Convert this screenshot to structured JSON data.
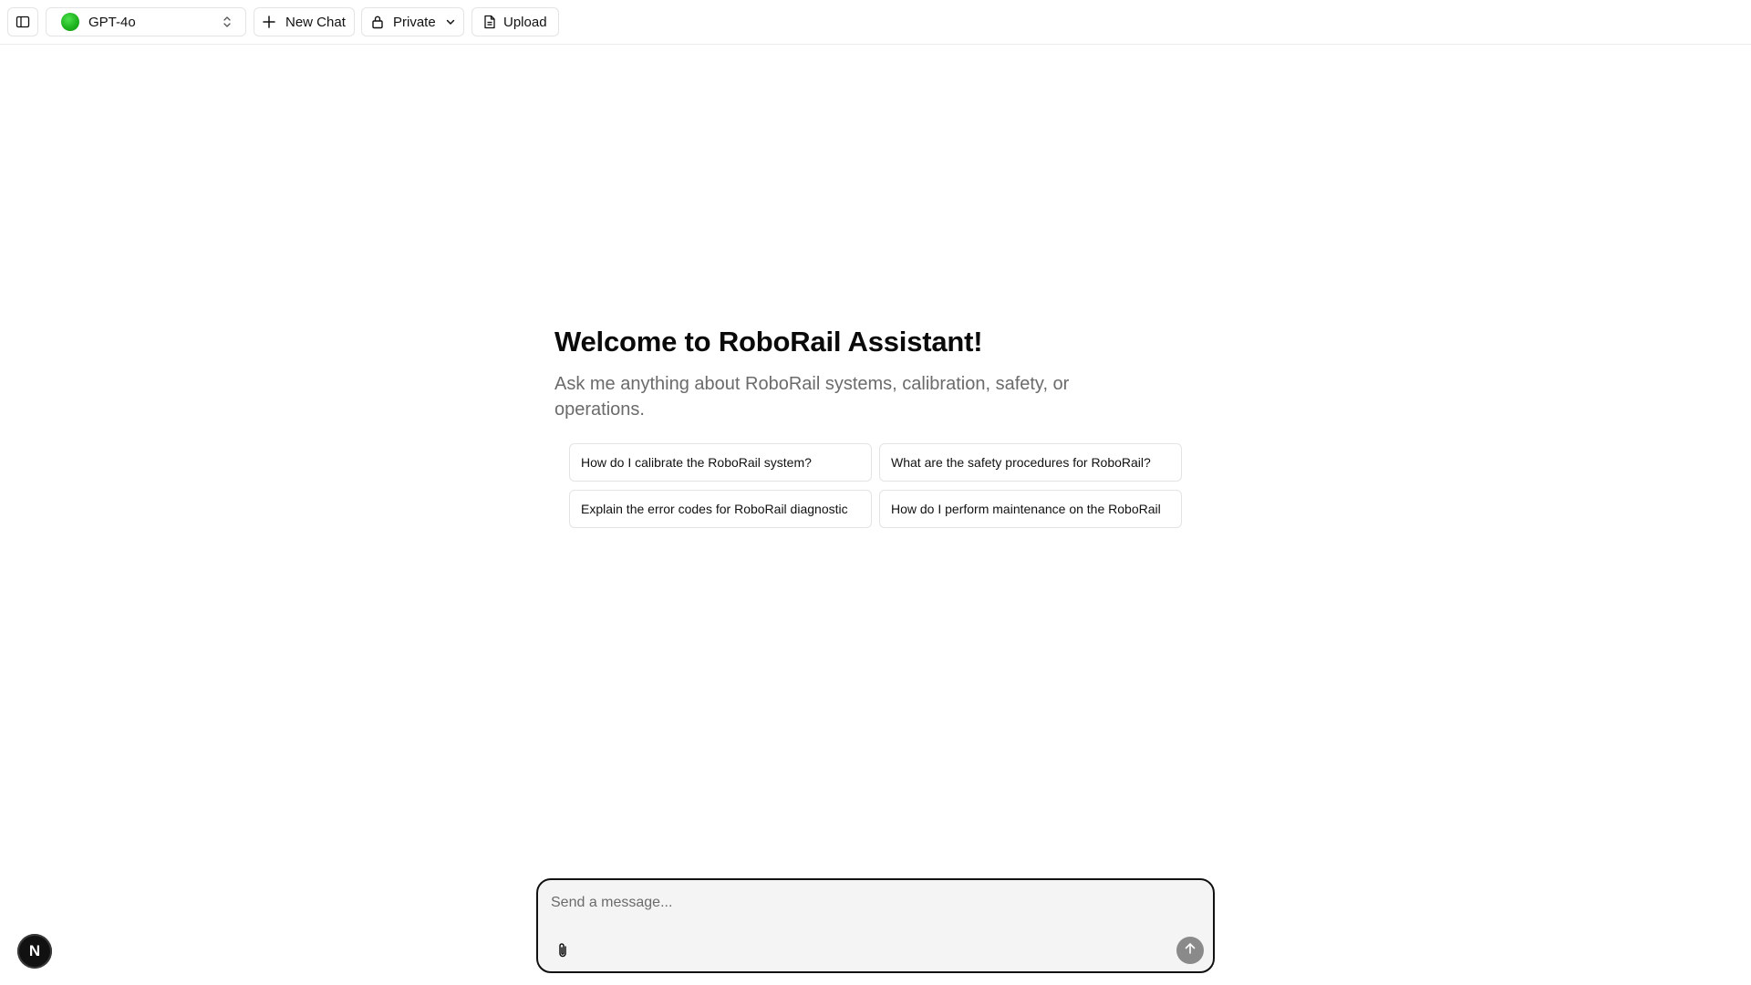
{
  "toolbar": {
    "model": {
      "label": "GPT-4o",
      "dot_color": "#22c022"
    },
    "new_chat_label": "New Chat",
    "visibility_label": "Private",
    "upload_label": "Upload"
  },
  "welcome": {
    "title": "Welcome to RoboRail Assistant!",
    "subtitle": "Ask me anything about RoboRail systems, calibration, safety, or operations."
  },
  "suggestions": [
    "How do I calibrate the RoboRail system?",
    "What are the safety procedures for RoboRail?",
    "Explain the error codes for RoboRail diagnostic",
    "How do I perform maintenance on the RoboRail"
  ],
  "composer": {
    "placeholder": "Send a message..."
  },
  "avatar": {
    "initial": "N"
  },
  "icons": [
    "sidebar-toggle-icon",
    "chevrons-up-down-icon",
    "plus-icon",
    "lock-icon",
    "chevron-down-icon",
    "file-icon",
    "paperclip-icon",
    "arrow-up-icon"
  ]
}
